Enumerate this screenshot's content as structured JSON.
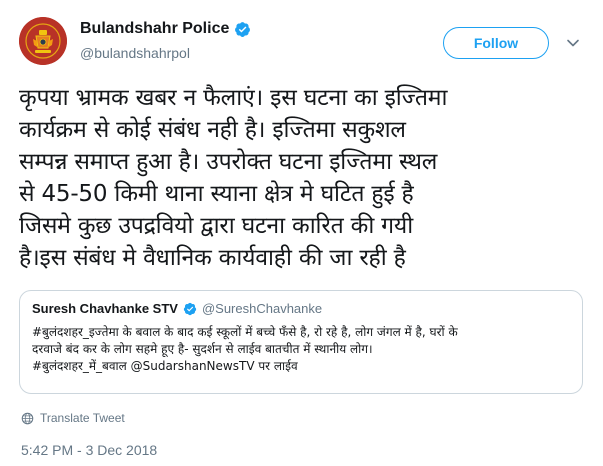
{
  "account": {
    "display_name": "Bulandshahr Police",
    "handle": "@bulandshahrpol",
    "verified": true,
    "avatar_icon": "uttar-pradesh-police-emblem-icon"
  },
  "actions": {
    "follow_label": "Follow",
    "more_icon": "chevron-down-icon"
  },
  "tweet": {
    "text": "कृपया भ्रामक खबर न फैलाएं। इस घटना का इज्तिमा\nकार्यक्रम से कोई संबंध नही है। इज्तिमा सकुशल\nसम्पन्न समाप्त हुआ है। उपरोक्त घटना इज्तिमा स्थल\nसे 45-50 किमी थाना स्याना क्षेत्र मे घटित हुई है\nजिसमे कुछ उपद्रवियो द्वारा घटना कारित की गयी\nहै।इस संबंध मे वैधानिक कार्यवाही की जा रही है"
  },
  "quoted_tweet": {
    "display_name": "Suresh Chavhanke STV",
    "handle": "@SureshChavhanke",
    "verified": true,
    "text": "#बुलंदशहर_इज्तेमा के बवाल के बाद कई स्कूलों में बच्चे फँसे है, रो रहे है, लोग जंगल में है, घरों के\nदरवाजे बंद कर के लोग सहमे हूए है- सुदर्शन से लाईव बातचीत में स्थानीय लोग।\n#बुलंदशहर_में_बवाल @SudarshanNewsTV पर लाईव"
  },
  "translate_label": "Translate Tweet",
  "timestamp": "5:42 PM - 3 Dec 2018",
  "colors": {
    "accent": "#1da1f2",
    "secondary_text": "#657786",
    "border": "#ccd6dd",
    "avatar_bg": "#c0392b"
  }
}
